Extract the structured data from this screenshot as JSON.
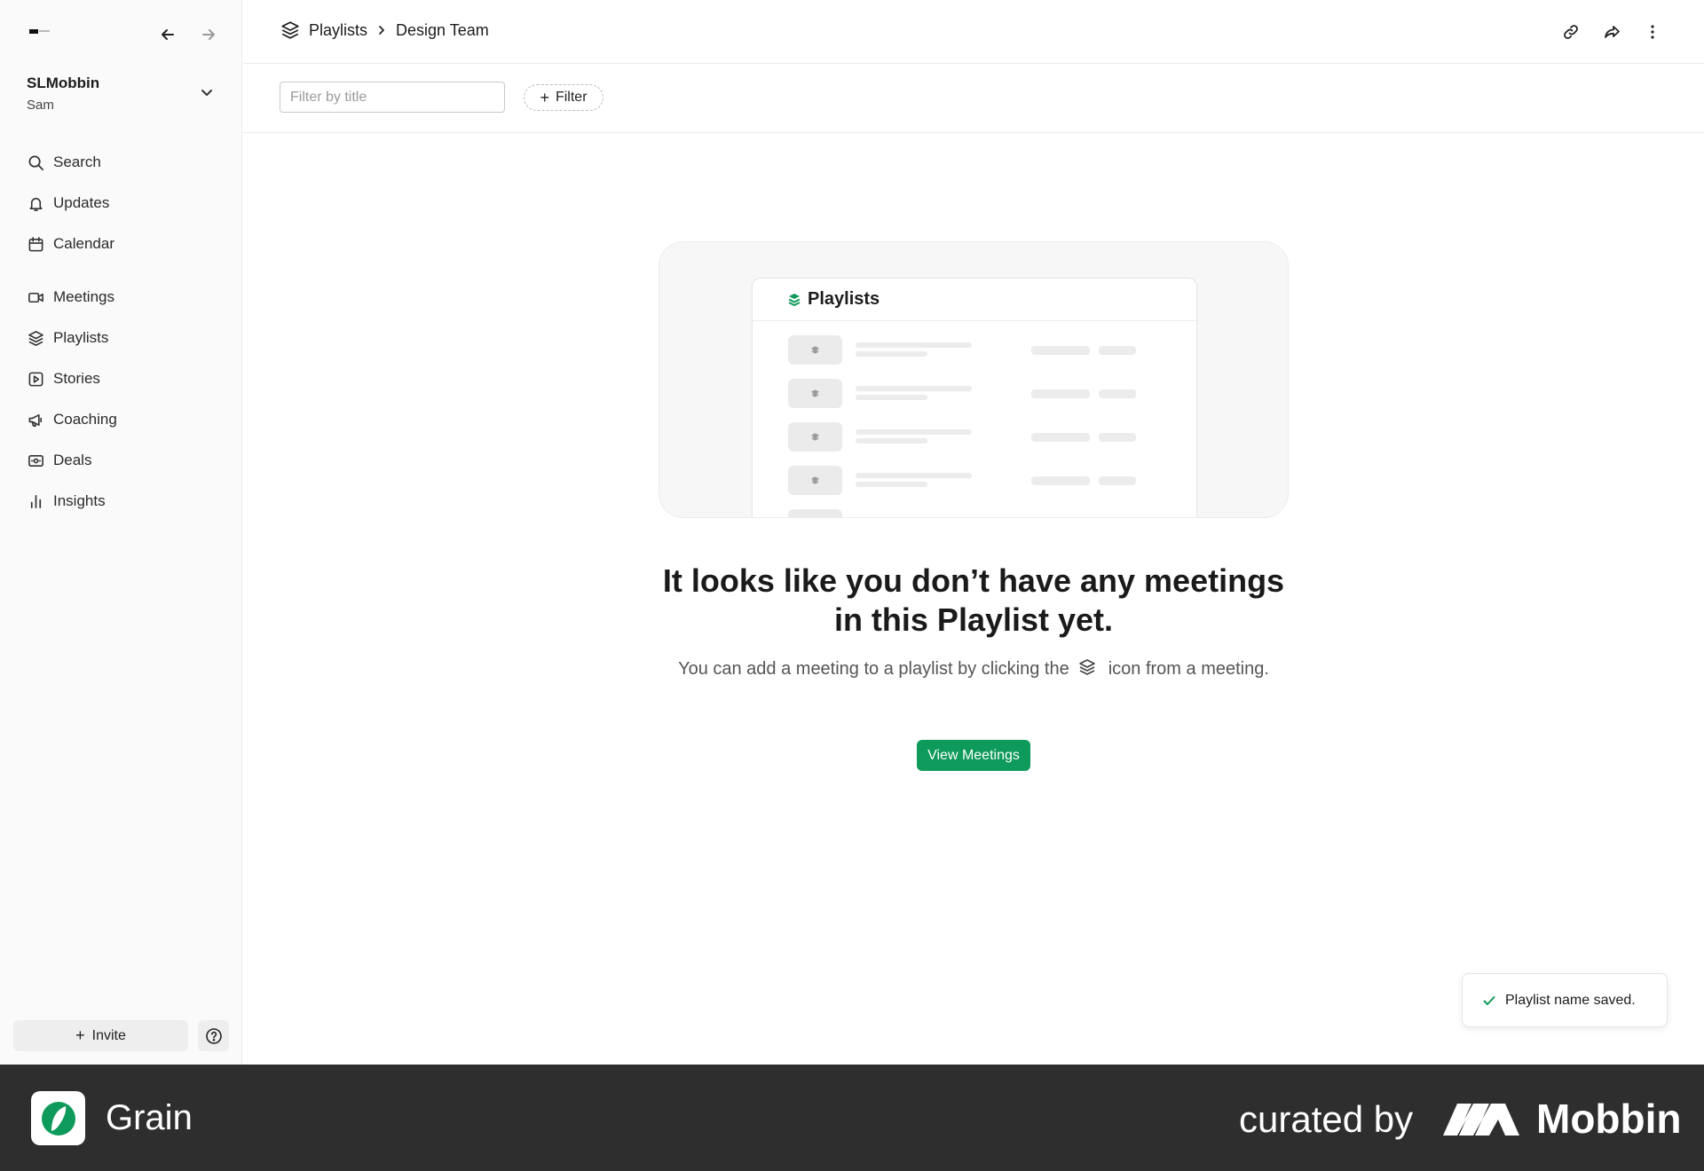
{
  "sidebar": {
    "workspace_name": "SLMobbin",
    "workspace_user": "Sam",
    "items_top": [
      {
        "label": "Search",
        "icon": "search-icon"
      },
      {
        "label": "Updates",
        "icon": "bell-icon"
      },
      {
        "label": "Calendar",
        "icon": "calendar-icon"
      }
    ],
    "items_main": [
      {
        "label": "Meetings",
        "icon": "video-icon"
      },
      {
        "label": "Playlists",
        "icon": "layers-icon"
      },
      {
        "label": "Stories",
        "icon": "play-square-icon"
      },
      {
        "label": "Coaching",
        "icon": "megaphone-icon"
      },
      {
        "label": "Deals",
        "icon": "deals-icon"
      },
      {
        "label": "Insights",
        "icon": "bar-chart-icon"
      }
    ],
    "invite_label": "Invite"
  },
  "header": {
    "breadcrumb": [
      "Playlists",
      "Design Team"
    ]
  },
  "toolbar": {
    "filter_placeholder": "Filter by title",
    "filter_button": "Filter"
  },
  "illustration": {
    "title": "Playlists"
  },
  "empty_state": {
    "title": "It looks like you don’t have any meetings in this Playlist yet.",
    "desc_before": "You can add a meeting to a playlist by clicking the",
    "desc_after": "icon from a meeting.",
    "button": "View Meetings"
  },
  "toast": {
    "message": "Playlist name saved."
  },
  "footer": {
    "app_name": "Grain",
    "curated_by": "curated by",
    "brand": "Mobbin"
  },
  "colors": {
    "accent": "#0d9a5a",
    "footer_bg": "#2e2e2e",
    "sidebar_bg": "#fafafa"
  }
}
